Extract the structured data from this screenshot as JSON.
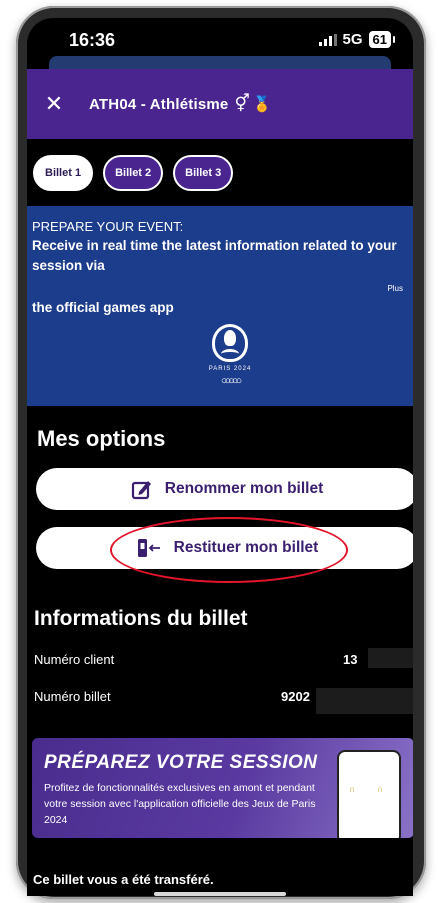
{
  "status_bar": {
    "time": "16:36",
    "network": "5G",
    "battery": "61"
  },
  "header": {
    "title": "ATH04 - Athlétisme",
    "gender_symbol": "⚥",
    "medal_symbol": "🏅"
  },
  "tabs": [
    {
      "label": "Billet 1",
      "active": true
    },
    {
      "label": "Billet 2",
      "active": false
    },
    {
      "label": "Billet 3",
      "active": false
    }
  ],
  "banner": {
    "heading": "PREPARE YOUR EVENT:",
    "text": "Receive in real time the latest information related to your session via",
    "more": "Plus",
    "app_line": "the official games app",
    "logo_text": "PARIS 2024"
  },
  "options": {
    "title": "Mes options",
    "rename_label": "Renommer mon billet",
    "restituer_label": "Restituer mon billet"
  },
  "ticket_info": {
    "title": "Informations du billet",
    "rows": [
      {
        "label": "Numéro client",
        "value": "13"
      },
      {
        "label": "Numéro billet",
        "value": "9202"
      }
    ]
  },
  "promo": {
    "title": "PRÉPAREZ VOTRE SESSION",
    "text": "Profitez de fonctionnalités exclusives en amont et pendant votre session avec l'application officielle des Jeux de Paris 2024"
  },
  "transfer_note": "Ce billet vous a été transféré.",
  "colors": {
    "header": "#4a2590",
    "banner": "#1c3c8c",
    "button_text": "#3a1f6e",
    "highlight": "#e3152b"
  }
}
